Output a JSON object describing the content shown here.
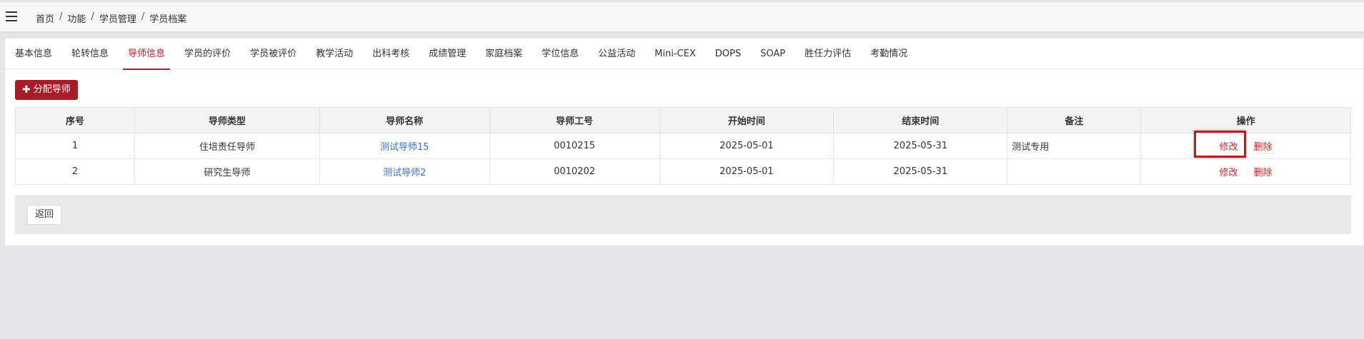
{
  "breadcrumb": [
    "首页",
    "功能",
    "学员管理",
    "学员档案"
  ],
  "tabs": [
    {
      "label": "基本信息",
      "active": false
    },
    {
      "label": "轮转信息",
      "active": false
    },
    {
      "label": "导师信息",
      "active": true
    },
    {
      "label": "学员的评价",
      "active": false
    },
    {
      "label": "学员被评价",
      "active": false
    },
    {
      "label": "教学活动",
      "active": false
    },
    {
      "label": "出科考核",
      "active": false
    },
    {
      "label": "成绩管理",
      "active": false
    },
    {
      "label": "家庭档案",
      "active": false
    },
    {
      "label": "学位信息",
      "active": false
    },
    {
      "label": "公益活动",
      "active": false
    },
    {
      "label": "Mini-CEX",
      "active": false
    },
    {
      "label": "DOPS",
      "active": false
    },
    {
      "label": "SOAP",
      "active": false
    },
    {
      "label": "胜任力评估",
      "active": false
    },
    {
      "label": "考勤情况",
      "active": false
    }
  ],
  "assign_button": {
    "label": "分配导师"
  },
  "table": {
    "headers": [
      "序号",
      "导师类型",
      "导师名称",
      "导师工号",
      "开始时间",
      "结束时间",
      "备注",
      "操作"
    ],
    "rows": [
      {
        "index": "1",
        "type": "住培责任导师",
        "name": "测试导师15",
        "code": "0010215",
        "start": "2025-05-01",
        "end": "2025-05-31",
        "remark": "测试专用",
        "edit": "修改",
        "delete": "删除"
      },
      {
        "index": "2",
        "type": "研究生导师",
        "name": "测试导师2",
        "code": "0010202",
        "start": "2025-05-01",
        "end": "2025-05-31",
        "remark": "",
        "edit": "修改",
        "delete": "删除"
      }
    ]
  },
  "back_button": {
    "label": "返回"
  },
  "colors": {
    "accent": "#b31b2a",
    "link": "#3a6fc9",
    "highlight": "#cc1414"
  }
}
